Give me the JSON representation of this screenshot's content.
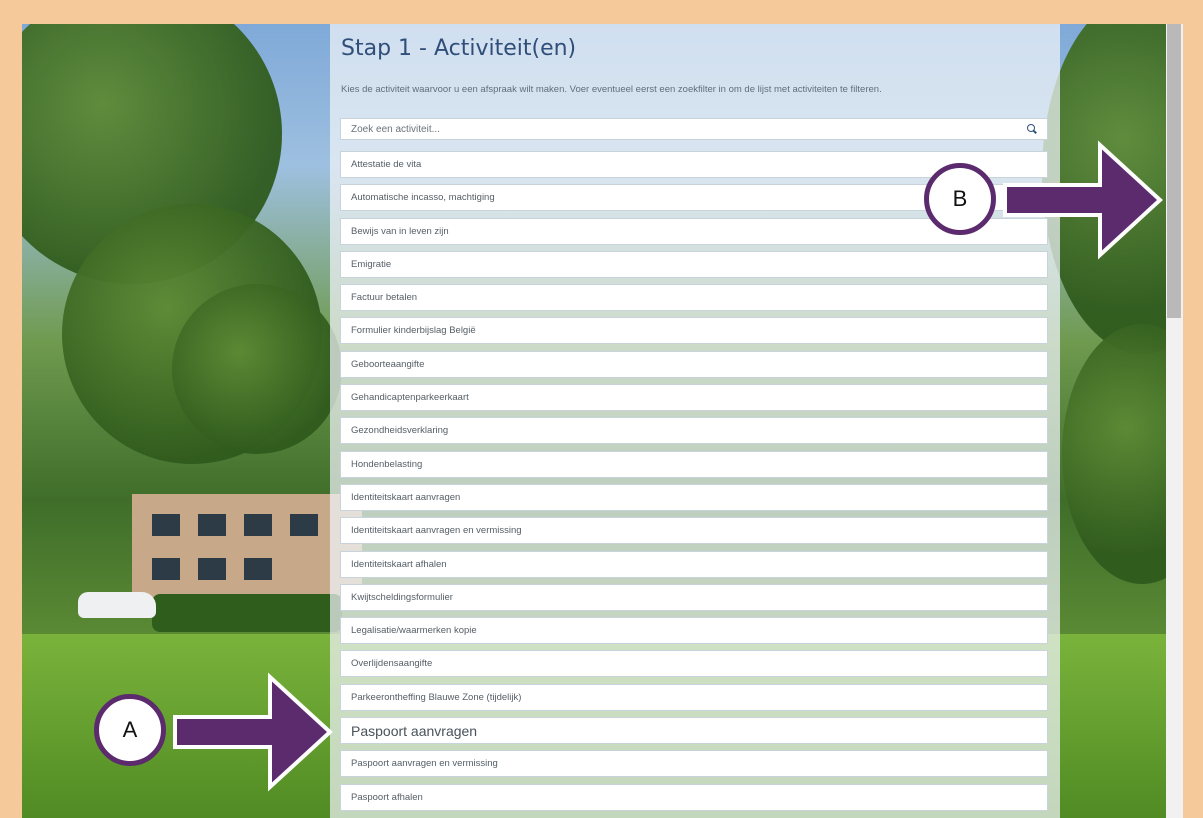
{
  "title": "Stap 1 - Activiteit(en)",
  "subtitle": "Kies de activiteit waarvoor u een afspraak wilt maken. Voer eventueel eerst een zoekfilter in om de lijst met activiteiten te filteren.",
  "search": {
    "placeholder": "Zoek een activiteit..."
  },
  "activities": [
    "Attestatie de vita",
    "Automatische incasso, machtiging",
    "Bewijs van in leven zijn",
    "Emigratie",
    "Factuur betalen",
    "Formulier kinderbijslag België",
    "Geboorteaangifte",
    "Gehandicaptenparkeerkaart",
    "Gezondheidsverklaring",
    "Hondenbelasting",
    "Identiteitskaart aanvragen",
    "Identiteitskaart aanvragen en vermissing",
    "Identiteitskaart afhalen",
    "Kwijtscheldingsformulier",
    "Legalisatie/waarmerken kopie",
    "Overlijdensaangifte",
    "Parkeerontheffing Blauwe Zone (tijdelijk)",
    "Paspoort aanvragen",
    "Paspoort aanvragen en vermissing",
    "Paspoort afhalen"
  ],
  "highlighted_activity_index": 17,
  "annotations": {
    "marker_a": "A",
    "marker_b": "B"
  },
  "colors": {
    "frame": "#f6c99a",
    "arrow": "#5c2b6e",
    "title": "#2f4f7a"
  }
}
